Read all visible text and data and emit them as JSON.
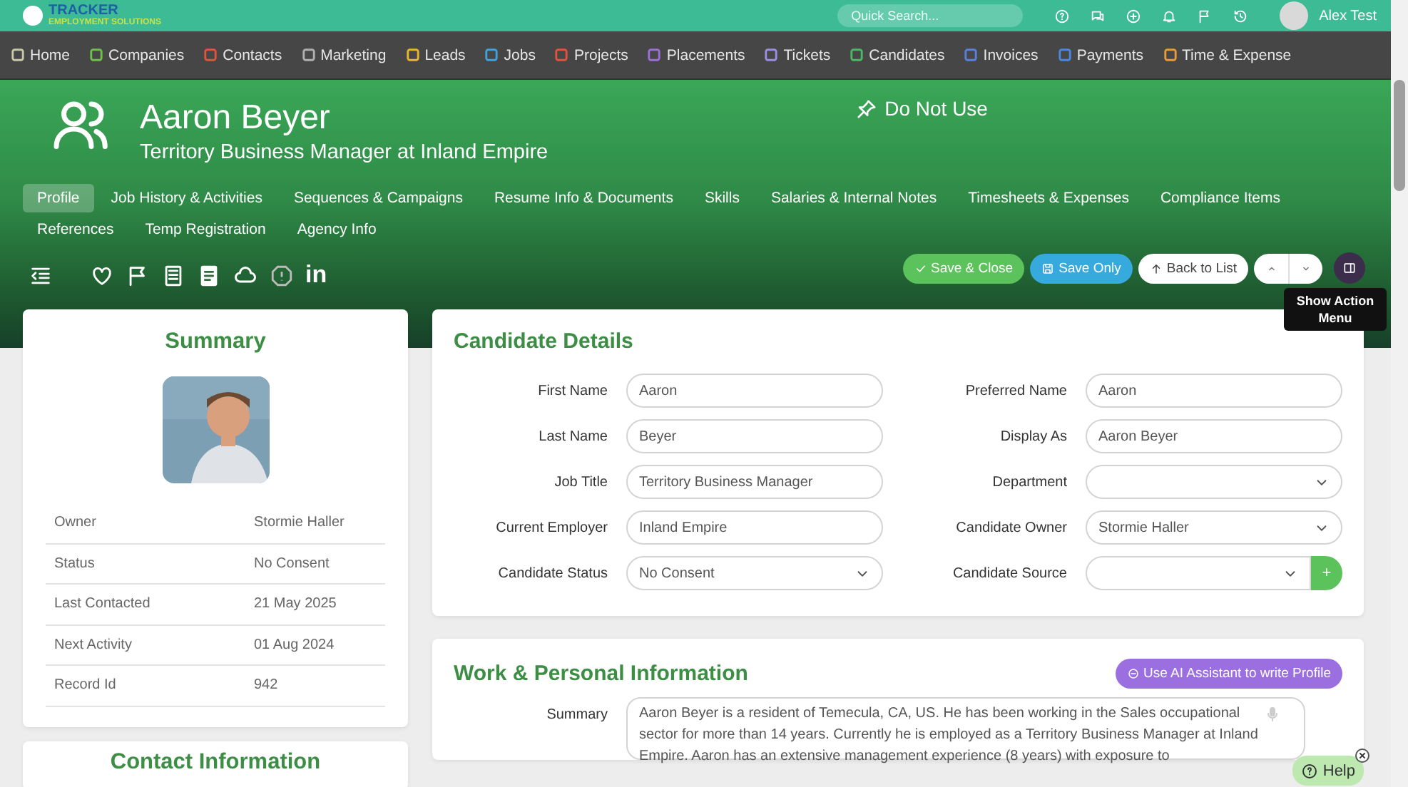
{
  "header": {
    "logo_title": "TRACKER",
    "logo_subtitle": "EMPLOYMENT SOLUTIONS",
    "search": {
      "placeholder": "Quick Search..."
    },
    "user_name": "Alex Test"
  },
  "nav": [
    {
      "label": "Home",
      "color": "#c8c8a8"
    },
    {
      "label": "Companies",
      "color": "#6fbf4a"
    },
    {
      "label": "Contacts",
      "color": "#e0533d"
    },
    {
      "label": "Marketing",
      "color": "#b0b0b0"
    },
    {
      "label": "Leads",
      "color": "#e8b52c"
    },
    {
      "label": "Jobs",
      "color": "#3ea3dc"
    },
    {
      "label": "Projects",
      "color": "#e0533d"
    },
    {
      "label": "Placements",
      "color": "#9b6fd6"
    },
    {
      "label": "Tickets",
      "color": "#9b8ee0"
    },
    {
      "label": "Candidates",
      "color": "#4cb866"
    },
    {
      "label": "Invoices",
      "color": "#5b7fdc"
    },
    {
      "label": "Payments",
      "color": "#4b86e0"
    },
    {
      "label": "Time & Expense",
      "color": "#e89a3c"
    }
  ],
  "record": {
    "name": "Aaron Beyer",
    "subtitle": "Territory Business Manager at Inland Empire",
    "pin_label": "Do Not Use"
  },
  "tabs": [
    {
      "label": "Profile",
      "selected": true
    },
    {
      "label": "Job History & Activities",
      "selected": false
    },
    {
      "label": "Sequences & Campaigns",
      "selected": false
    },
    {
      "label": "Resume Info & Documents",
      "selected": false
    },
    {
      "label": "Skills",
      "selected": false
    },
    {
      "label": "Salaries & Internal Notes",
      "selected": false
    },
    {
      "label": "Timesheets & Expenses",
      "selected": false
    },
    {
      "label": "Compliance Items",
      "selected": false
    },
    {
      "label": "References",
      "selected": false
    },
    {
      "label": "Temp Registration",
      "selected": false
    },
    {
      "label": "Agency Info",
      "selected": false
    }
  ],
  "toolbar": {
    "linkedin_label": "in"
  },
  "actions": {
    "save_close": "Save & Close",
    "save_only": "Save Only",
    "back": "Back to List",
    "tooltip": "Show Action Menu"
  },
  "summary": {
    "title": "Summary",
    "rows": [
      {
        "label": "Owner",
        "value": "Stormie Haller"
      },
      {
        "label": "Status",
        "value": "No Consent"
      },
      {
        "label": "Last Contacted",
        "value": "21 May 2025"
      },
      {
        "label": "Next Activity",
        "value": "01 Aug 2024"
      },
      {
        "label": "Record Id",
        "value": "942"
      }
    ]
  },
  "details": {
    "title": "Candidate Details",
    "fields": [
      {
        "label": "First Name",
        "value": "Aaron",
        "kind": "text"
      },
      {
        "label": "Preferred Name",
        "value": "Aaron",
        "kind": "text"
      },
      {
        "label": "Last Name",
        "value": "Beyer",
        "kind": "text"
      },
      {
        "label": "Display As",
        "value": "Aaron Beyer",
        "kind": "text"
      },
      {
        "label": "Job Title",
        "value": "Territory Business Manager",
        "kind": "text"
      },
      {
        "label": "Department",
        "kind": "select"
      },
      {
        "label": "Current Employer",
        "value": "Inland Empire",
        "kind": "text"
      },
      {
        "label": "Candidate Owner",
        "value": "Stormie Haller",
        "kind": "select"
      },
      {
        "label": "Candidate Status",
        "value": "No Consent",
        "kind": "select"
      },
      {
        "label": "Candidate Source",
        "kind": "select_add",
        "add_label": "+"
      }
    ]
  },
  "work": {
    "title": "Work & Personal Information",
    "ai_button": "Use AI Assistant to write Profile",
    "fields": [
      {
        "label": "Summary",
        "value": "Aaron Beyer is a resident of Temecula, CA, US. He has been working in the Sales occupational sector for more than 14 years. Currently he is employed as a Territory Business Manager at Inland Empire. Aaron has an extensive management experience (8 years) with exposure to"
      }
    ]
  },
  "contact": {
    "title": "Contact Information"
  },
  "help": {
    "label": "Help"
  }
}
